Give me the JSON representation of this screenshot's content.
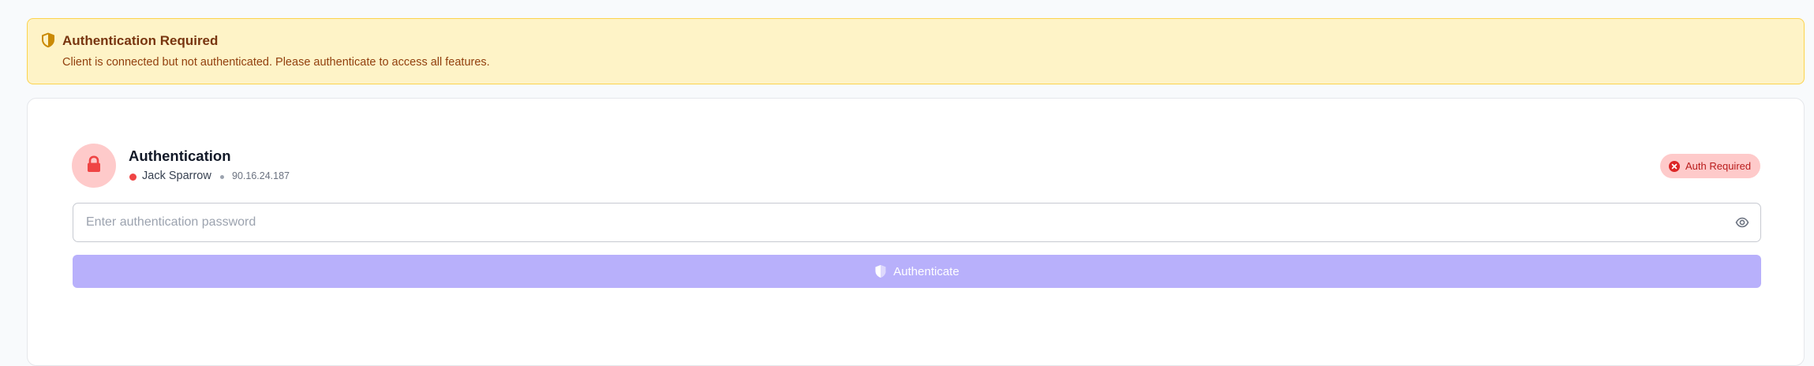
{
  "alert": {
    "icon": "shield-half-icon",
    "title": "Authentication Required",
    "message": "Client is connected but not authenticated. Please authenticate to access all features."
  },
  "auth_card": {
    "icon": "lock-icon",
    "title": "Authentication",
    "client_name": "Jack Sparrow",
    "client_ip": "90.16.24.187",
    "status_color": "#ef4444",
    "badge": {
      "icon": "x-circle-icon",
      "label": "Auth Required"
    },
    "password_input": {
      "value": "",
      "placeholder": "Enter authentication password",
      "toggle_icon": "eye-icon"
    },
    "authenticate_button": {
      "icon": "shield-check-icon",
      "label": "Authenticate"
    }
  },
  "colors": {
    "alert_bg": "#fef3c7",
    "alert_border": "#fcd34d",
    "danger": "#ef4444",
    "accent_disabled": "#b8b0fb"
  }
}
